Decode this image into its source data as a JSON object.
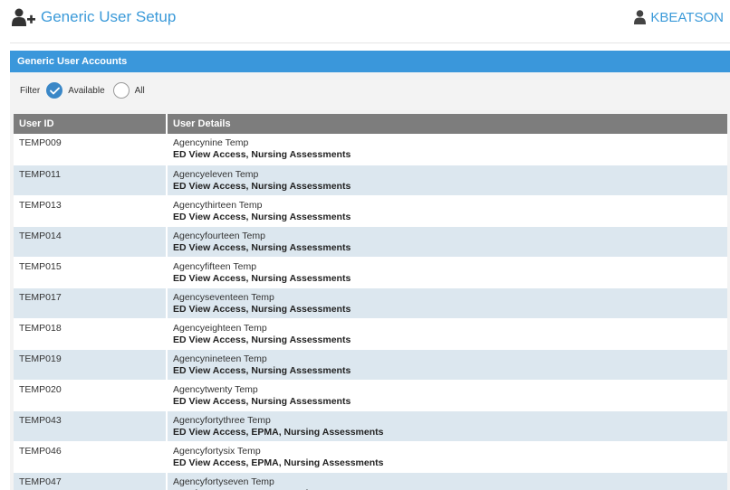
{
  "header": {
    "title": "Generic User Setup",
    "icon": "add-user-icon",
    "user": {
      "name": "KBEATSON",
      "icon": "user-icon"
    }
  },
  "colors": {
    "accent": "#3b9ad9",
    "panel_heading_bg": "#3a97db",
    "table_header_bg": "#7d7d7d",
    "row_alt_bg": "#dce7ef",
    "radio_checked": "#3a87c7"
  },
  "panel": {
    "heading": "Generic User Accounts",
    "filter": {
      "label": "Filter",
      "options": [
        {
          "label": "Available",
          "selected": true
        },
        {
          "label": "All",
          "selected": false
        }
      ]
    },
    "table": {
      "columns": [
        "User ID",
        "User Details"
      ],
      "rows": [
        {
          "user_id": "TEMP009",
          "name": "Agencynine Temp",
          "roles": "ED View Access, Nursing Assessments"
        },
        {
          "user_id": "TEMP011",
          "name": "Agencyeleven Temp",
          "roles": "ED View Access, Nursing Assessments"
        },
        {
          "user_id": "TEMP013",
          "name": "Agencythirteen Temp",
          "roles": "ED View Access, Nursing Assessments"
        },
        {
          "user_id": "TEMP014",
          "name": "Agencyfourteen Temp",
          "roles": "ED View Access, Nursing Assessments"
        },
        {
          "user_id": "TEMP015",
          "name": "Agencyfifteen Temp",
          "roles": "ED View Access, Nursing Assessments"
        },
        {
          "user_id": "TEMP017",
          "name": "Agencyseventeen Temp",
          "roles": "ED View Access, Nursing Assessments"
        },
        {
          "user_id": "TEMP018",
          "name": "Agencyeighteen Temp",
          "roles": "ED View Access, Nursing Assessments"
        },
        {
          "user_id": "TEMP019",
          "name": "Agencynineteen Temp",
          "roles": "ED View Access, Nursing Assessments"
        },
        {
          "user_id": "TEMP020",
          "name": "Agencytwenty Temp",
          "roles": "ED View Access, Nursing Assessments"
        },
        {
          "user_id": "TEMP043",
          "name": "Agencyfortythree Temp",
          "roles": "ED View Access, EPMA, Nursing Assessments"
        },
        {
          "user_id": "TEMP046",
          "name": "Agencyfortysix Temp",
          "roles": "ED View Access, EPMA, Nursing Assessments"
        },
        {
          "user_id": "TEMP047",
          "name": "Agencyfortyseven Temp",
          "roles": "ED View Access, EPMA, Nursing Assessments"
        }
      ]
    }
  }
}
